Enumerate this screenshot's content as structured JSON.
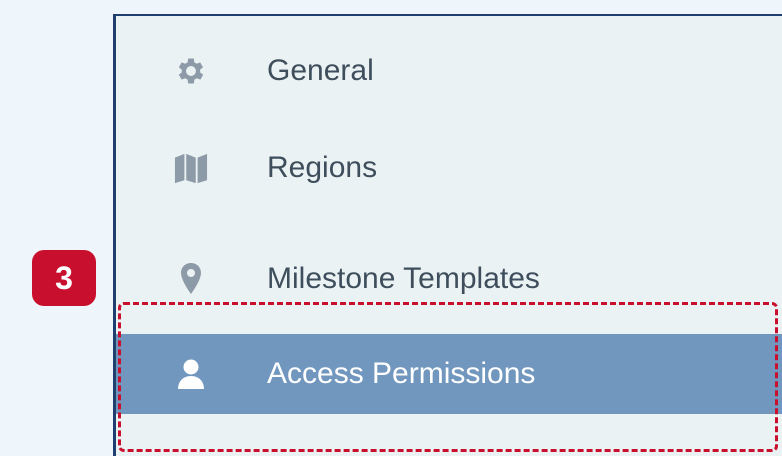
{
  "menu": {
    "items": [
      {
        "label": "General",
        "icon": "gear-icon"
      },
      {
        "label": "Regions",
        "icon": "map-icon"
      },
      {
        "label": "Milestone Templates",
        "icon": "map-marker-icon"
      },
      {
        "label": "Access Permissions",
        "icon": "user-icon",
        "active": true
      }
    ]
  },
  "annotation": {
    "step_number": "3"
  },
  "colors": {
    "page_background": "#eef5fb",
    "panel_background": "#ebf2f3",
    "panel_border": "#1f3f6f",
    "active_item_background": "#7197be",
    "icon_color": "#8d9aa7",
    "text_color": "#3e4e5c",
    "annotation_red": "#c8102e"
  }
}
